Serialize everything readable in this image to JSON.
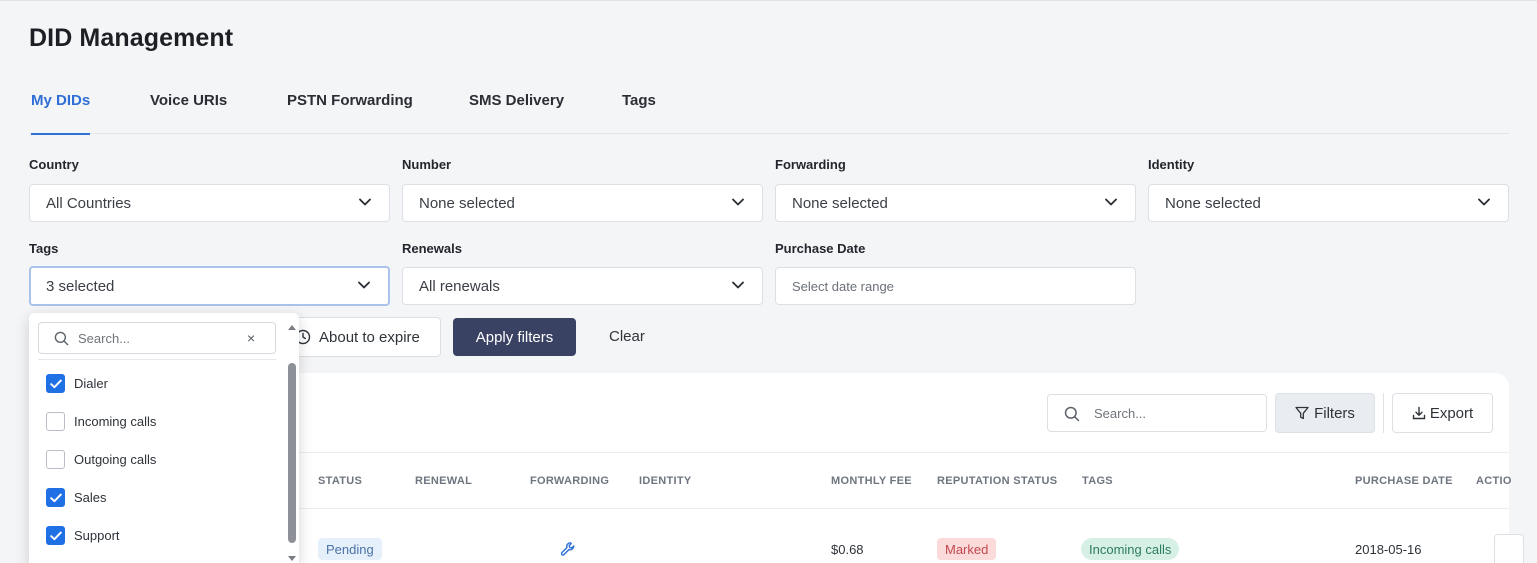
{
  "page": {
    "title": "DID Management"
  },
  "tabs": [
    {
      "label": "My DIDs",
      "active": true
    },
    {
      "label": "Voice URIs",
      "active": false
    },
    {
      "label": "PSTN Forwarding",
      "active": false
    },
    {
      "label": "SMS Delivery",
      "active": false
    },
    {
      "label": "Tags",
      "active": false
    }
  ],
  "filters": {
    "country": {
      "label": "Country",
      "value": "All Countries"
    },
    "number": {
      "label": "Number",
      "value": "None selected"
    },
    "forwarding": {
      "label": "Forwarding",
      "value": "None selected"
    },
    "identity": {
      "label": "Identity",
      "value": "None selected"
    },
    "tags": {
      "label": "Tags",
      "value": "3 selected"
    },
    "renewals": {
      "label": "Renewals",
      "value": "All renewals"
    },
    "purchase_date": {
      "label": "Purchase Date",
      "placeholder": "Select date range"
    }
  },
  "actions": {
    "about_to_expire": "About to expire",
    "apply": "Apply filters",
    "clear": "Clear"
  },
  "tags_dropdown": {
    "search_placeholder": "Search...",
    "clear_symbol": "×",
    "options": [
      {
        "label": "Dialer",
        "checked": true
      },
      {
        "label": "Incoming calls",
        "checked": false
      },
      {
        "label": "Outgoing calls",
        "checked": false
      },
      {
        "label": "Sales",
        "checked": true
      },
      {
        "label": "Support",
        "checked": true
      }
    ]
  },
  "table": {
    "search_placeholder": "Search...",
    "filters_label": "Filters",
    "export_label": "Export",
    "columns": [
      "STATUS",
      "RENEWAL",
      "FORWARDING",
      "IDENTITY",
      "MONTHLY FEE",
      "REPUTATION STATUS",
      "TAGS",
      "PURCHASE DATE",
      "ACTIO"
    ],
    "rows": [
      {
        "status": "Pending",
        "forwarding_icon": "wrench-icon",
        "monthly_fee": "$0.68",
        "reputation": "Marked",
        "tag": "Incoming calls",
        "purchase_date": "2018-05-16"
      }
    ]
  },
  "colors": {
    "accent": "#2f6fd6",
    "primary_button": "#3a4263",
    "checkbox": "#1f6fe5"
  }
}
